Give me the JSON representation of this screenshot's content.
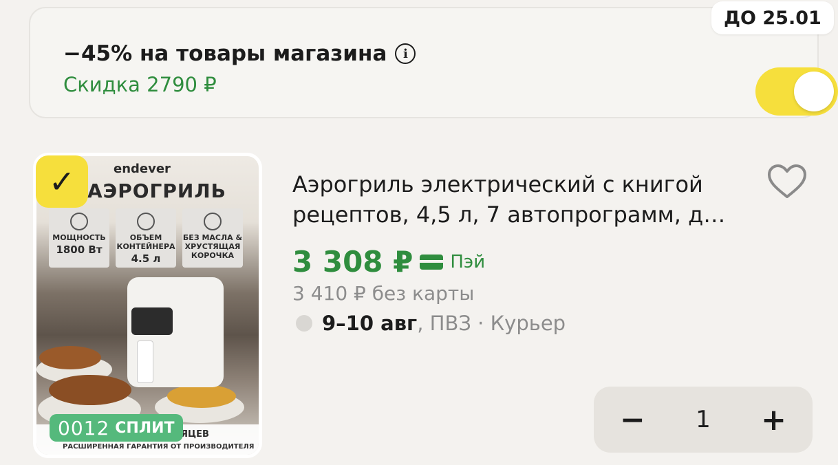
{
  "promo": {
    "title": "−45% на товары магазина",
    "discount": "Скидка 2790 ₽",
    "deadline": "ДО 25.01",
    "toggle_on": true,
    "icons": {
      "info": "info-icon"
    }
  },
  "product": {
    "title": "Аэрогриль электрический с книгой рецептов, 4,5 л, 7 автопрограмм, д…",
    "price": "3 308 ₽",
    "pay_label": "Пэй",
    "old_price": "3 410 ₽  без карты",
    "delivery_date": "9–10 авг",
    "delivery_rest": ", ПВЗ · Курьер",
    "quantity": "1",
    "minus_label": "−",
    "plus_label": "+",
    "split_num": "0012",
    "split_label": "СПЛИТ",
    "selected": true
  },
  "image": {
    "brand": "endever",
    "heading": "АЭРОГРИЛЬ",
    "specs": [
      {
        "label": "МОЩНОСТЬ",
        "value": "1800 Вт"
      },
      {
        "label": "ОБЪЕМ КОНТЕЙНЕРА",
        "value": "4.5 л"
      },
      {
        "label": "БЕЗ МАСЛА & ХРУСТЯЩАЯ КОРОЧКА",
        "value": ""
      }
    ],
    "bottom_main": "ЯЦЕВ",
    "bottom_sub": "РАСШИРЕННАЯ ГАРАНТИЯ ОТ ПРОИЗВОДИТЕЛЯ"
  },
  "colors": {
    "accent_green": "#2f8d3e",
    "toggle_yellow": "#f6df3c",
    "split_green": "#55b97c"
  }
}
